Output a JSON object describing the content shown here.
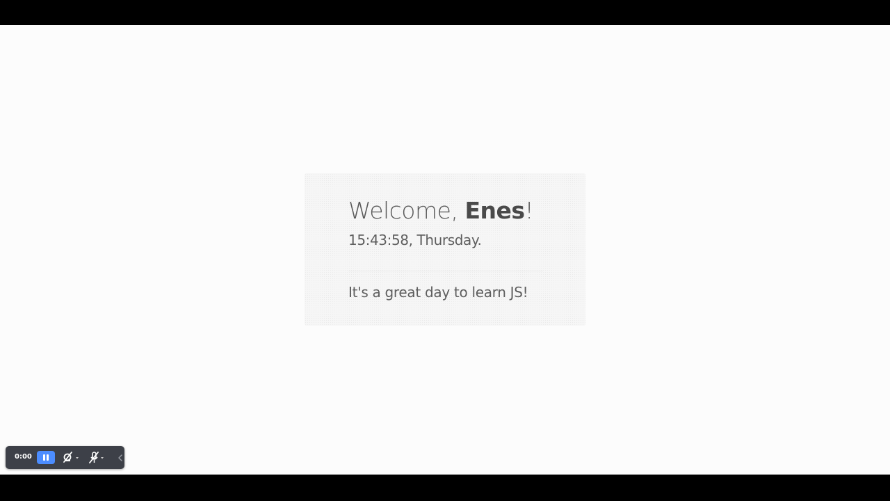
{
  "greeting": {
    "prefix": "Welcome, ",
    "name": "Enes",
    "suffix": "!"
  },
  "clock": {
    "text": "15:43:58, Thursday."
  },
  "message": {
    "text": "It's a great day to learn JS!"
  },
  "recorder": {
    "timer": "0:00",
    "pause_icon": "pause-icon",
    "camera_icon": "camera-off-icon",
    "mic_icon": "mic-off-icon",
    "collapse_icon": "chevron-left-icon",
    "accent_color": "#4c8dff",
    "background_color": "#3d4048"
  }
}
